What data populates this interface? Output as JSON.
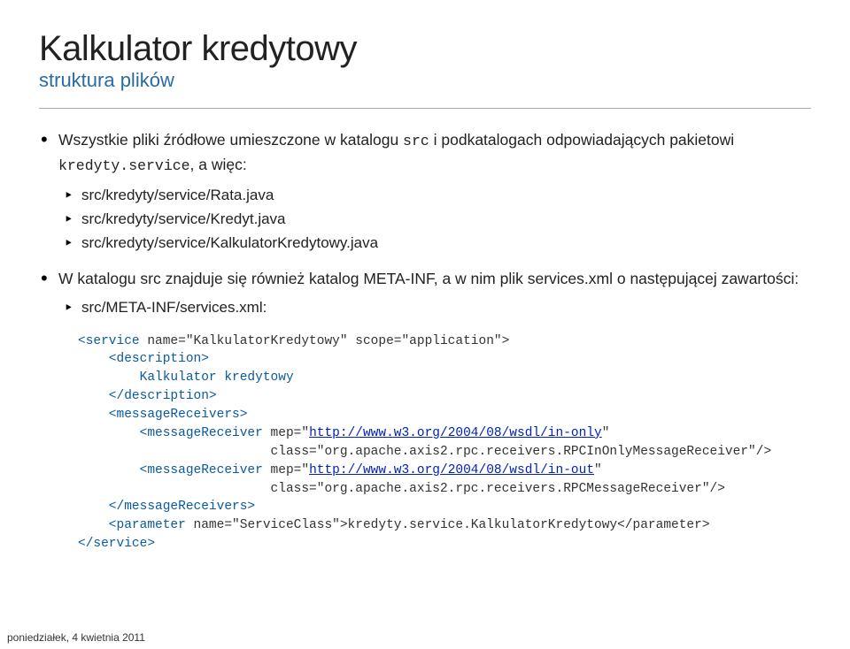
{
  "header": {
    "title": "Kalkulator kredytowy",
    "subtitle": "struktura plików"
  },
  "bullets": {
    "0": {
      "prefix": "Wszystkie pliki źródłowe umieszczone w katalogu ",
      "code1": "src",
      "mid": " i podkatalogach odpowiadających pakietowi ",
      "code2": "kredyty.service",
      "suffix": ", a więc:",
      "items": {
        "0": "src/kredyty/service/Rata.java",
        "1": "src/kredyty/service/Kredyt.java",
        "2": "src/kredyty/service/KalkulatorKredytowy.java"
      }
    },
    "1": {
      "text": "W katalogu src znajduje się również katalog META-INF, a w nim plik services.xml o następującej zawartości:",
      "items": {
        "0": "src/META-INF/services.xml:"
      }
    }
  },
  "xml": {
    "l0a": "<service ",
    "l0b": "name=\"KalkulatorKredytowy\" scope=\"application\">",
    "l1": "    <description>",
    "l2": "        Kalkulator kredytowy",
    "l3": "    </description>",
    "l4": "    <messageReceivers>",
    "l5a": "        <messageReceiver ",
    "l5b": "mep=\"",
    "l5link": "http://www.w3.org/2004/08/wsdl/in-only",
    "l5c": "\"",
    "l6a": "                         ",
    "l6b": "class=\"org.apache.axis2.rpc.receivers.RPCInOnlyMessageReceiver\"/>",
    "l7a": "        <messageReceiver ",
    "l7b": "mep=\"",
    "l7link": "http://www.w3.org/2004/08/wsdl/in-out",
    "l7c": "\"",
    "l8a": "                         ",
    "l8b": "class=\"org.apache.axis2.rpc.receivers.RPCMessageReceiver\"/>",
    "l9": "    </messageReceivers>",
    "l10a": "    <parameter ",
    "l10b": "name=\"ServiceClass\">kredyty.service.KalkulatorKredytowy</parameter>",
    "l11": "</service>"
  },
  "footer": "poniedziałek, 4 kwietnia 2011"
}
